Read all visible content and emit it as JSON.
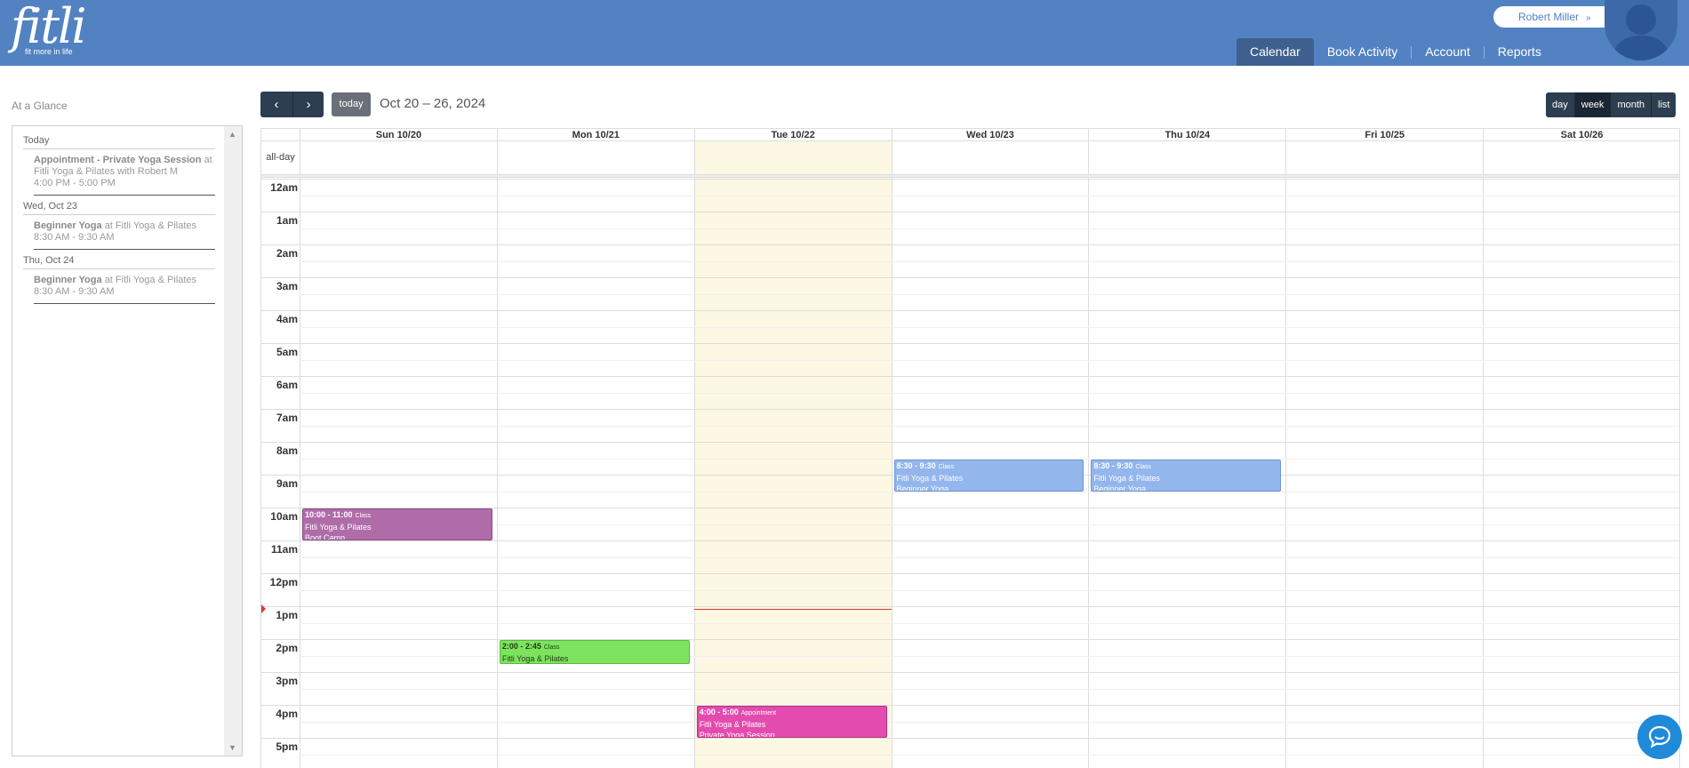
{
  "header": {
    "logo_text": "fitli",
    "logo_tagline": "fit more in life",
    "user_name": "Robert Miller",
    "user_chevron": "»",
    "nav": [
      {
        "label": "Calendar",
        "active": true
      },
      {
        "label": "Book Activity",
        "active": false
      },
      {
        "label": "Account",
        "active": false
      },
      {
        "label": "Reports",
        "active": false
      }
    ]
  },
  "sidebar": {
    "title": "At a Glance",
    "groups": [
      {
        "date": "Today",
        "items": [
          {
            "title": "Appointment - Private Yoga Session",
            "location": "at Fitli Yoga & Pilates with Robert M",
            "time": "4:00 PM - 5:00 PM"
          }
        ]
      },
      {
        "date": "Wed, Oct 23",
        "items": [
          {
            "title": "Beginner Yoga",
            "location": "at Fitli Yoga & Pilates",
            "time": "8:30 AM - 9:30 AM"
          }
        ]
      },
      {
        "date": "Thu, Oct 24",
        "items": [
          {
            "title": "Beginner Yoga",
            "location": "at Fitli Yoga & Pilates",
            "time": "8:30 AM - 9:30 AM"
          }
        ]
      }
    ],
    "scroll_up_icon": "triangle-up",
    "scroll_down_icon": "triangle-down"
  },
  "toolbar": {
    "prev_icon": "‹",
    "next_icon": "›",
    "today_label": "today",
    "date_range": "Oct 20 – 26, 2024",
    "views": [
      {
        "label": "day",
        "active": false
      },
      {
        "label": "week",
        "active": true
      },
      {
        "label": "month",
        "active": false
      },
      {
        "label": "list",
        "active": false
      }
    ]
  },
  "calendar": {
    "allday_label": "all-day",
    "days": [
      {
        "label": "Sun 10/20",
        "today": false
      },
      {
        "label": "Mon 10/21",
        "today": false
      },
      {
        "label": "Tue 10/22",
        "today": true
      },
      {
        "label": "Wed 10/23",
        "today": false
      },
      {
        "label": "Thu 10/24",
        "today": false
      },
      {
        "label": "Fri 10/25",
        "today": false
      },
      {
        "label": "Sat 10/26",
        "today": false
      }
    ],
    "hours": [
      "12am",
      "1am",
      "2am",
      "3am",
      "4am",
      "5am",
      "6am",
      "7am",
      "8am",
      "9am",
      "10am",
      "11am",
      "12pm",
      "1pm",
      "2pm",
      "3pm",
      "4pm",
      "5pm"
    ],
    "now_hour": 13.08,
    "events": [
      {
        "day": 0,
        "start": 10.0,
        "end": 11.0,
        "time": "10:00 - 11:00",
        "kind": "Class",
        "line1": "Fitli Yoga & Pilates",
        "line2": "Boot Camp",
        "color": "#b06ca8",
        "border": "#8a4d83",
        "text_color": "#ffffff"
      },
      {
        "day": 1,
        "start": 14.0,
        "end": 14.75,
        "time": "2:00 - 2:45",
        "kind": "Class",
        "line1": "Fitli Yoga & Pilates",
        "line2": "",
        "color": "#7de35e",
        "border": "#5cb83f",
        "text_color": "#1e3d12"
      },
      {
        "day": 2,
        "start": 16.0,
        "end": 17.0,
        "time": "4:00 - 5:00",
        "kind": "Appointment",
        "line1": "Fitli Yoga & Pilates",
        "line2": "Private Yoga Session",
        "color": "#e44bae",
        "border": "#b5327f",
        "text_color": "#ffffff"
      },
      {
        "day": 3,
        "start": 8.5,
        "end": 9.5,
        "time": "8:30 - 9:30",
        "kind": "Class",
        "line1": "Fitli Yoga & Pilates",
        "line2": "Beginner Yoga",
        "color": "#93b6ec",
        "border": "#6f95d4",
        "text_color": "#ffffff"
      },
      {
        "day": 4,
        "start": 8.5,
        "end": 9.5,
        "time": "8:30 - 9:30",
        "kind": "Class",
        "line1": "Fitli Yoga & Pilates",
        "line2": "Beginner Yoga",
        "color": "#93b6ec",
        "border": "#6f95d4",
        "text_color": "#ffffff"
      }
    ]
  },
  "colors": {
    "header_bg": "#5282c2",
    "nav_active_bg": "#3f5f8f",
    "toolbar_btn": "#2c3e50",
    "today_col": "#fcf8e3",
    "now_line": "#d83a3a",
    "chat_btn": "#1f8ad8"
  },
  "chat_icon": "chat-bubble-icon"
}
